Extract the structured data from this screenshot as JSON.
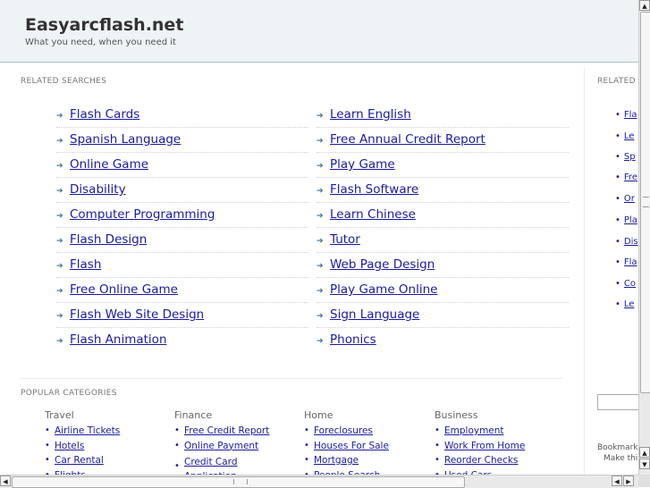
{
  "header": {
    "title": "Easyarcflash.net",
    "tagline": "What you need, when you need it"
  },
  "related": {
    "label": "RELATED SEARCHES",
    "left": [
      "Flash Cards",
      "Spanish Language",
      "Online Game",
      "Disability",
      "Computer Programming",
      "Flash Design",
      "Flash",
      "Free Online Game",
      "Flash Web Site Design",
      "Flash Animation"
    ],
    "right": [
      "Learn English",
      "Free Annual Credit Report",
      "Play Game",
      "Flash Software",
      "Learn Chinese",
      "Tutor",
      "Web Page Design",
      "Play Game Online",
      "Sign Language",
      "Phonics"
    ]
  },
  "popular": {
    "label": "POPULAR CATEGORIES",
    "categories": [
      {
        "title": "Travel",
        "items": [
          "Airline Tickets",
          "Hotels",
          "Car Rental",
          "Flights"
        ]
      },
      {
        "title": "Finance",
        "items": [
          "Free Credit Report",
          "Online Payment",
          "Credit Card Application"
        ]
      },
      {
        "title": "Home",
        "items": [
          "Foreclosures",
          "Houses For Sale",
          "Mortgage",
          "People Search"
        ]
      },
      {
        "title": "Business",
        "items": [
          "Employment",
          "Work From Home",
          "Reorder Checks",
          "Used Cars"
        ]
      }
    ]
  },
  "sidebar": {
    "label": "RELATED",
    "items": [
      "Fla",
      "Le",
      "Sp",
      "Fre",
      "Or",
      "Pla",
      "Dis",
      "Fla",
      "Co",
      "Le"
    ],
    "bookmark": "Bookmark",
    "make_this": "Make thi"
  },
  "scrollbars": {
    "up": "▲",
    "down": "▼",
    "left": "◀",
    "right": "▶"
  }
}
